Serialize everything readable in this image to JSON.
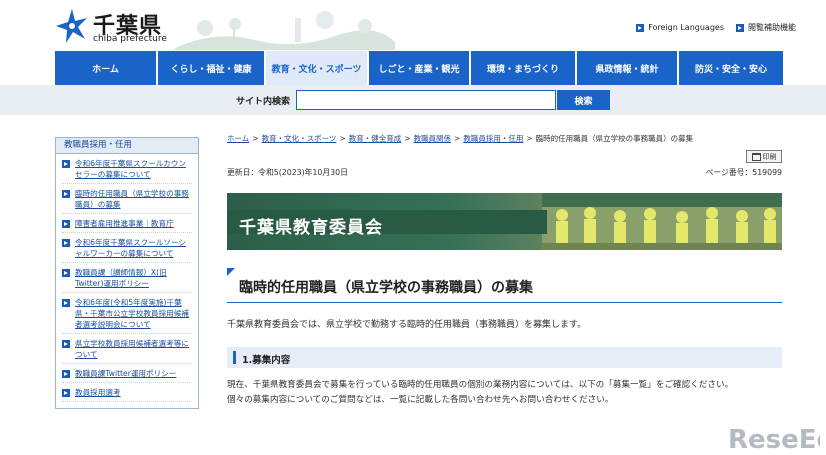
{
  "header": {
    "logo_name": "千葉県",
    "logo_sub": "chiba prefecture",
    "links": [
      "Foreign Languages",
      "閲覧補助機能"
    ]
  },
  "nav": [
    "ホーム",
    "くらし・福祉・健康",
    "教育・文化・スポーツ",
    "しごと・産業・観光",
    "環境・まちづくり",
    "県政情報・統計",
    "防災・安全・安心"
  ],
  "search": {
    "label": "サイト内検索",
    "placeholder": "",
    "button": "検索"
  },
  "sidebar": {
    "heading": "教職員採用・任用",
    "items": [
      "令和6年度千葉県スクールカウンセラーの募集について",
      "臨時的任用職員（県立学校の事務職員）の募集",
      "障害者雇用推進事業｜教育庁",
      "令和6年度千葉県スクールソーシャルワーカーの募集について",
      "教職員課（讃師情報）X(旧Twitter)運用ポリシー",
      "令和6年度(令和5年度実施)千葉県・千葉市公立学校教員採用候補者選考説明会について",
      "県立学校教員採用候補者選考等について",
      "教職員課Twitter運用ポリシー",
      "教員採用選考"
    ]
  },
  "main": {
    "breadcrumb": [
      "ホーム",
      "教育・文化・スポーツ",
      "教育・健全育成",
      "教職員関係",
      "教職員採用・任用"
    ],
    "breadcrumb_current": "臨時的任用職員（県立学校の事務職員）の募集",
    "print_label": "印刷",
    "updated": "更新日：令和5(2023)年10月30日",
    "page_no": "ページ番号：519099",
    "banner_title": "千葉県教育委員会",
    "title": "臨時的任用職員（県立学校の事務職員）の募集",
    "lead": "千葉県教育委員会では、県立学校で勤務する臨時的任用職員（事務職員）を募集します。",
    "section_title": "1.募集内容",
    "body_lines": [
      "現在、千葉県教育委員会で募集を行っている臨時的任用職員の個別の業務内容については、以下の「募集一覧」をご確認ください。",
      "個々の募集内容についてのご質問などは、一覧に記載した各問い合わせ先へお問い合わせください。"
    ]
  },
  "watermark": "ReseEd",
  "colors": {
    "nav_blue": "#1a63c9",
    "banner_green": "#285b43",
    "search_bg": "#e9eef5"
  }
}
